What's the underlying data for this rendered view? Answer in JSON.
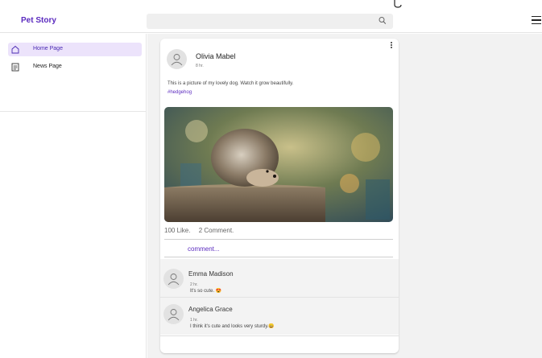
{
  "app": {
    "brand": "Pet Story"
  },
  "search": {
    "placeholder": ""
  },
  "sidebar": {
    "items": [
      {
        "label": "Home Page",
        "icon": "home-icon",
        "active": true
      },
      {
        "label": "News Page",
        "icon": "document-icon",
        "active": false
      }
    ]
  },
  "post": {
    "author": "Olivia Mabel",
    "time": "8 hr.",
    "caption": "This is a picture of my lovely dog. Watch it grow beautifully.",
    "tag": "#hedgehog",
    "likes": "100 Like.",
    "comments_count": "2 Comment.",
    "comment_button": "comment..."
  },
  "comments": [
    {
      "name": "Emma Madison",
      "time": "2 hr.",
      "text": "It's so cute. 😍"
    },
    {
      "name": "Angelica Grace",
      "time": "1 hr.",
      "text": "I think it's cute and looks very sturdy.😀"
    }
  ],
  "colors": {
    "accent": "#5b2bbf",
    "active_bg": "#ece3fb",
    "main_bg": "#f2f2f2"
  }
}
